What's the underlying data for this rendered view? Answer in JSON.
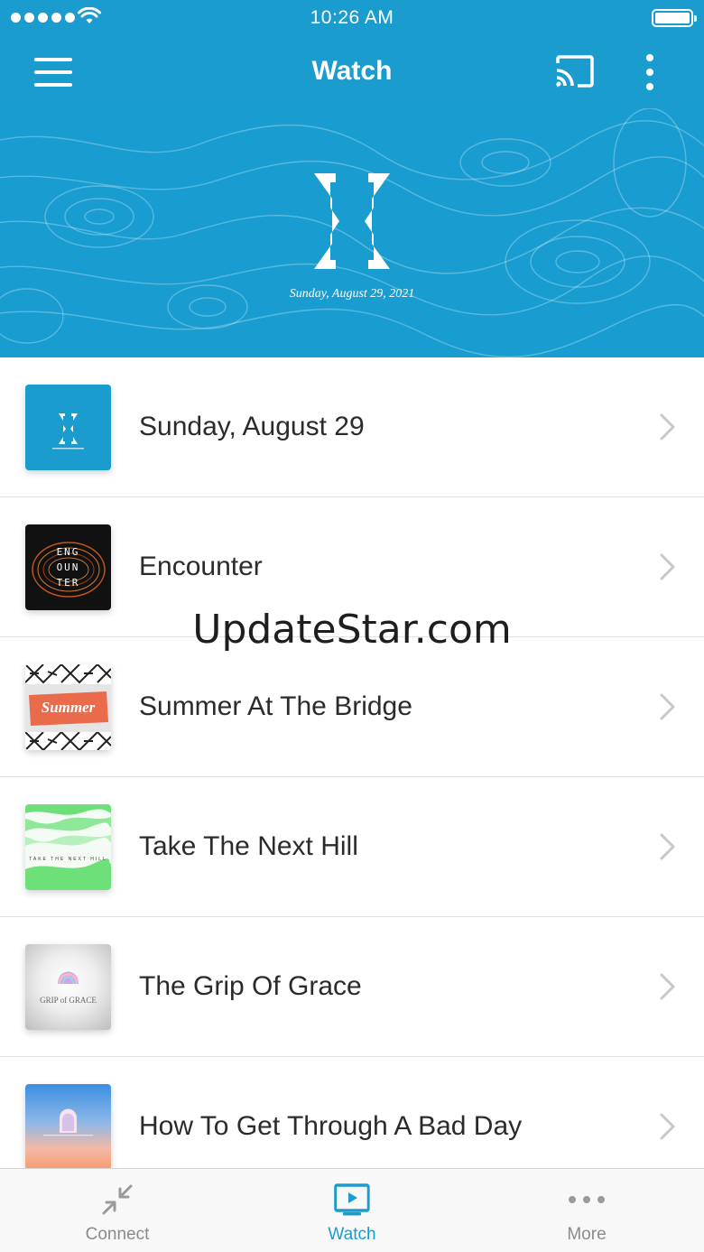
{
  "status_bar": {
    "time": "10:26 AM"
  },
  "nav": {
    "title": "Watch"
  },
  "hero": {
    "date": "Sunday, August 29, 2021"
  },
  "list": {
    "items": [
      {
        "label": "Sunday, August 29"
      },
      {
        "label": "Encounter",
        "thumb_text": [
          "ENG",
          "OUN",
          "TER"
        ]
      },
      {
        "label": "Summer At The Bridge",
        "thumb_text": "Summer"
      },
      {
        "label": "Take The Next Hill",
        "thumb_text": "TAKE THE NEXT HILL"
      },
      {
        "label": "The Grip Of Grace",
        "thumb_text": "GRIP of GRACE"
      },
      {
        "label": "How To Get Through A Bad Day"
      }
    ]
  },
  "watermark": "UpdateStar.com",
  "tabs": [
    {
      "label": "Connect",
      "icon": "arrows-in-icon",
      "active": false
    },
    {
      "label": "Watch",
      "icon": "tv-play-icon",
      "active": true
    },
    {
      "label": "More",
      "icon": "more-dots-icon",
      "active": false
    }
  ],
  "colors": {
    "primary": "#1a9ccf",
    "tab_inactive": "#8a8a8a"
  }
}
